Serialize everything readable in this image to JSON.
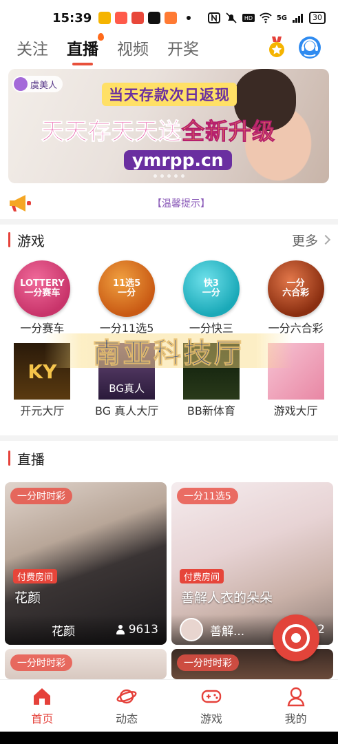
{
  "status_bar": {
    "time": "15:39",
    "app_icons": [
      "#f5b400",
      "#ff5a4a",
      "#e8473a",
      "#111111",
      "#ff7a33"
    ],
    "signal": "5G",
    "battery": "30"
  },
  "top_nav": {
    "tabs": [
      {
        "label": "关注",
        "active": false
      },
      {
        "label": "直播",
        "active": true
      },
      {
        "label": "视频",
        "active": false
      },
      {
        "label": "开奖",
        "active": false
      }
    ]
  },
  "banner": {
    "brand": "虞美人",
    "line1": "当天存款次日返现",
    "line2_main": "天天存天天送",
    "line2_highlight": "全新升级",
    "url": "ymrpp.cn"
  },
  "notice": {
    "text": "【温馨提示】"
  },
  "games_section": {
    "title": "游戏",
    "more_label": "更多",
    "watermark": "南亚科技厅",
    "items": [
      {
        "label": "一分赛车",
        "badge": "LOTTERY\n一分赛车",
        "color": "#c8346a"
      },
      {
        "label": "一分11选5",
        "badge": "11选5\n一分",
        "color": "#c95a14"
      },
      {
        "label": "一分快三",
        "badge": "快3\n一分",
        "color": "#1aa9b8"
      },
      {
        "label": "一分六合彩",
        "badge": "一分\n六合彩",
        "color": "#b5441e"
      },
      {
        "label": "开元大厅",
        "badge": "KY",
        "color": "#d89a2a"
      },
      {
        "label": "BG 真人大厅",
        "badge": "BG真人",
        "color": "#3a2a4a"
      },
      {
        "label": "BB新体育",
        "badge": "",
        "color": "#1a2a1a"
      },
      {
        "label": "游戏大厅",
        "badge": "",
        "color": "#e887a4"
      }
    ]
  },
  "live_section": {
    "title": "直播",
    "cards": [
      {
        "tag": "一分时时彩",
        "paid": "付费房间",
        "title": "花颜",
        "host": "花颜",
        "viewers": "9613"
      },
      {
        "tag": "一分11选5",
        "paid": "付费房间",
        "title": "善解人衣的朵朵",
        "host": "善解...",
        "viewers": "22"
      },
      {
        "tag": "一分时时彩"
      },
      {
        "tag": "一分时时彩"
      }
    ]
  },
  "bottom_nav": {
    "items": [
      {
        "label": "首页",
        "active": true
      },
      {
        "label": "动态",
        "active": false
      },
      {
        "label": "游戏",
        "active": false
      },
      {
        "label": "我的",
        "active": false
      }
    ]
  },
  "colors": {
    "accent": "#e5413a",
    "notice": "#8a5ab8"
  }
}
